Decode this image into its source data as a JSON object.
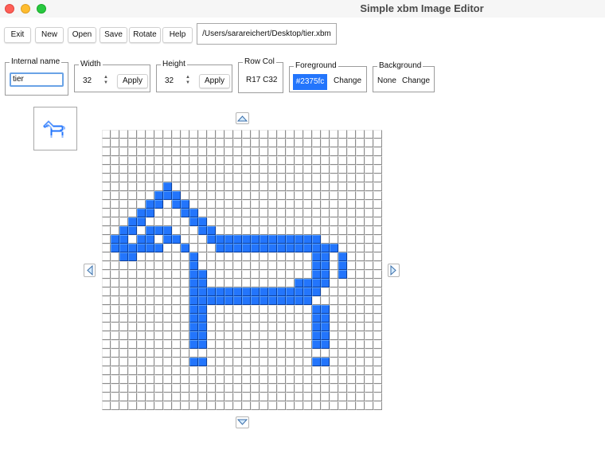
{
  "window": {
    "title": "Simple xbm Image Editor"
  },
  "toolbar": {
    "exit": "Exit",
    "new": "New",
    "open": "Open",
    "save": "Save",
    "rotate": "Rotate",
    "help": "Help",
    "file_path": "/Users/sarareichert/Desktop/tier.xbm"
  },
  "fields": {
    "internal_name": {
      "legend": "Internal name",
      "value": "tier"
    },
    "width": {
      "legend": "Width",
      "value": "32",
      "apply": "Apply"
    },
    "height": {
      "legend": "Height",
      "value": "32",
      "apply": "Apply"
    },
    "rowcol": {
      "legend": "Row Col",
      "value": "R17 C32"
    },
    "foreground": {
      "legend": "Foreground",
      "value": "#2375fc",
      "change": "Change"
    },
    "background": {
      "legend": "Background",
      "value": "None",
      "change": "Change"
    }
  },
  "colors": {
    "foreground": "#2375fc",
    "cell_off": "#ffffff"
  },
  "icons": {
    "preview": "bitmap-preview-icon",
    "scroll_up": "arrow-up-icon",
    "scroll_down": "arrow-down-icon",
    "scroll_left": "arrow-left-icon",
    "scroll_right": "arrow-right-icon"
  },
  "bitmap": {
    "width": 32,
    "height": 32,
    "rows": [
      "................................",
      "................................",
      "................................",
      "................................",
      "................................",
      "................................",
      ".......#........................",
      "......###.......................",
      ".....##.##......................",
      "....##...##.....................",
      "...##.....##....................",
      "..##.###...##...................",
      ".##.##.##...#############.......",
      ".######..#...##############.....",
      "..##......#.............##.#....",
      "..........#.............##.#....",
      "..........##............##.#....",
      "..........##..........####......",
      "..........###############.......",
      "..........##############........",
      "..........##............##......",
      "..........##............##......",
      "..........##............##......",
      "..........##............##......",
      "..........##............##......",
      "................................",
      "..........##............##......",
      "................................",
      "................................",
      "................................",
      "................................",
      "................................"
    ]
  }
}
